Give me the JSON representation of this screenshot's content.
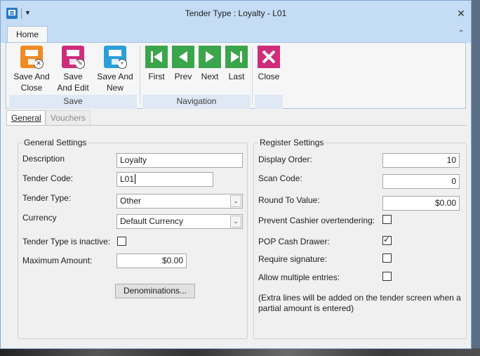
{
  "window": {
    "title": "Tender Type : Loyalty - L01"
  },
  "ribbon": {
    "tab_home": "Home",
    "buttons": {
      "save_and_close": "Save And\nClose",
      "save_and_edit": "Save\nAnd Edit",
      "save_and_new": "Save And\nNew",
      "first": "First",
      "prev": "Prev",
      "next": "Next",
      "last": "Last",
      "close": "Close"
    },
    "groups": {
      "save": "Save",
      "navigation": "Navigation"
    }
  },
  "tabs": {
    "general": "General",
    "vouchers": "Vouchers"
  },
  "general_settings": {
    "title": "General Settings",
    "description_label": "Description",
    "description_value": "Loyalty",
    "tender_code_label": "Tender Code:",
    "tender_code_value": "L01",
    "tender_type_label": "Tender Type:",
    "tender_type_value": "Other",
    "currency_label": "Currency",
    "currency_value": "Default Currency",
    "inactive_label": "Tender Type is inactive:",
    "inactive_checked": false,
    "max_amount_label": "Maximum Amount:",
    "max_amount_value": "$0.00",
    "denominations_button": "Denominations..."
  },
  "register_settings": {
    "title": "Register Settings",
    "display_order_label": "Display Order:",
    "display_order_value": "10",
    "scan_code_label": "Scan Code:",
    "scan_code_value": "0",
    "round_to_label": "Round To Value:",
    "round_to_value": "$0.00",
    "prevent_overtender_label": "Prevent Cashier overtendering:",
    "prevent_overtender_checked": false,
    "pop_drawer_label": "POP Cash Drawer:",
    "pop_drawer_checked": true,
    "require_signature_label": "Require signature:",
    "require_signature_checked": false,
    "allow_multiple_label": "Allow multiple entries:",
    "allow_multiple_checked": false,
    "note": "(Extra lines will be added on the tender screen when a partial amount is entered)"
  },
  "colors": {
    "titlebar": "#c4dcf5",
    "save_close_icon": "#f08a24",
    "save_edit_icon": "#cf2d7c",
    "save_new_icon": "#2a9fd8",
    "nav_icon": "#3ba54b",
    "close_icon": "#cf2d7c"
  }
}
